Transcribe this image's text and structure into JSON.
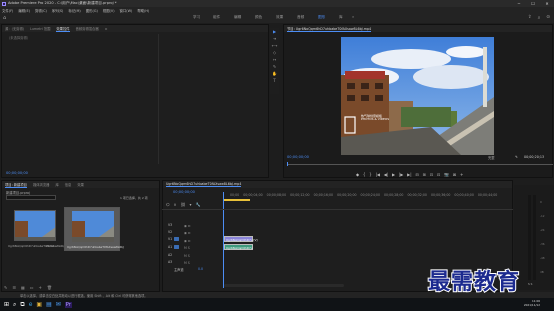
{
  "window": {
    "title": "Adobe Premiere Pro 2020 - C:\\用户\\Mac\\桌面\\新建项目.prproj *",
    "controls": [
      "─",
      "☐",
      "✕"
    ]
  },
  "menu": [
    "文件(F)",
    "编辑(E)",
    "剪辑(C)",
    "序列(S)",
    "标记(M)",
    "图形(G)",
    "视图(V)",
    "窗口(W)",
    "帮助(H)"
  ],
  "workspaces": {
    "tabs": [
      "学习",
      "组件",
      "编辑",
      "颜色",
      "效果",
      "音频",
      "图形",
      "库"
    ],
    "active": "图形",
    "more": "»"
  },
  "source_panel": {
    "tabs": [
      "源：(无剪辑)",
      "Lumetri 范围",
      "效果控件",
      "音频剪辑混合器"
    ],
    "active_tab": "效果控件",
    "message": "（未选择剪辑）",
    "menu_icon": "≡",
    "timecode": "00;00;00;00"
  },
  "program_panel": {
    "title": "节目: Ugr6NoQqm6hD7uhbabeT0fAXsaw8L6bJ.mp4",
    "timecode": "00;00;00;00",
    "fit_label": "完整",
    "duration": "00;00;20;13",
    "video_overlay": "热气球创意模板\nPHOTOS & VIDEOS"
  },
  "playback_controls": [
    "◆",
    "{",
    "}",
    "|◀",
    "◀|",
    "▶",
    "|▶",
    "▶|",
    "⊟",
    "⊞",
    "⊡",
    "⊡",
    "📷",
    "⊠",
    "+"
  ],
  "tools": [
    "▶",
    "⇥",
    "⟷",
    "◇",
    "↦",
    "✎",
    "✋",
    "T"
  ],
  "project_panel": {
    "tabs": [
      "项目: 新建项目",
      "媒体浏览器",
      "库",
      "信息",
      "效果"
    ],
    "active_tab": "项目: 新建项目",
    "filename": "新建项目.prproj",
    "search_placeholder": "",
    "item_count": "1 项已选择，共 2 项",
    "items": [
      {
        "name": "Ugr6NoQqm6hD7uhbabeT0fAXsaw8L6bJ.mp4",
        "duration": "20;13"
      },
      {
        "name": "Ugr6NoQqm6hD7uhbabeT0fAXsaw8L6bJ",
        "duration": "20;13"
      }
    ]
  },
  "timeline": {
    "tab_label": "Ugr6NoQqm6hD7uhbabeT0fAXsaw8L6bJ.mp4",
    "timecode": "00;00;00;00",
    "ruler": [
      "00;00",
      "00;00;04;00",
      "00;00;08;00",
      "00;00;12;00",
      "00;00;16;00",
      "00;00;20;00",
      "00;00;24;00",
      "00;00;28;00",
      "00;00;32;00",
      "00;00;36;00",
      "00;00;40;00",
      "00;00;44;00",
      "00;00;48;00"
    ],
    "video_tracks": [
      "V3",
      "V2",
      "V1"
    ],
    "audio_tracks": [
      "A1",
      "A2",
      "A3"
    ],
    "master": "主声道",
    "master_value": "0.0",
    "video_clip": "Ugr6NoQqm6hD7u [V]",
    "audio_clip": "Ugr6NoQqm6hD7u",
    "meter_labels": [
      "0",
      "-12",
      "-24",
      "-36",
      "-48",
      "dB"
    ],
    "solo": "S S"
  },
  "status_bar": {
    "text": "单击以选择，或单击空白处并拖动以进行框选。使用 Shift 、Alt 和 Ctrl 可获得其他选项。"
  },
  "taskbar": {
    "icons": [
      "⊞",
      "⌕",
      "⧉",
      "e",
      "▣",
      "▤",
      "✉",
      "Pr"
    ],
    "time": "11:06",
    "date": "2021/11/12"
  },
  "watermark": "最需教育"
}
